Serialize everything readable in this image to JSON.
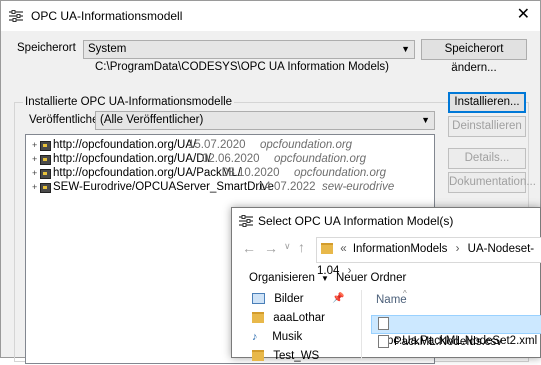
{
  "window": {
    "title": "OPC UA-Informationsmodell",
    "close_glyph": "✕"
  },
  "storage": {
    "label": "Speicherort",
    "value": "System",
    "path": "C:\\ProgramData\\CODESYS\\OPC UA Information Models)",
    "change_button": "Speicherort ändern..."
  },
  "installed": {
    "group_label": "Installierte OPC UA-Informationsmodelle",
    "publisher_label": "Veröffentlicher:",
    "publisher_value": "(Alle Veröffentlicher)",
    "items": [
      {
        "url": "http://opcfoundation.org/UA/",
        "date": "15.07.2020",
        "org": "opcfoundation.org"
      },
      {
        "url": "http://opcfoundation.org/UA/DI/",
        "date": "02.06.2020",
        "org": "opcfoundation.org"
      },
      {
        "url": "http://opcfoundation.org/UA/PackML/",
        "date": "08.10.2020",
        "org": "opcfoundation.org"
      },
      {
        "url": "SEW-Eurodrive/OPCUAServer_SmartDrive",
        "date": "14.07.2022",
        "org": "sew-eurodrive"
      }
    ]
  },
  "buttons": {
    "install": "Installieren...",
    "uninstall": "Deinstallieren",
    "details": "Details...",
    "docs": "Dokumentation..."
  },
  "file_dialog": {
    "title": "Select OPC UA Information Model(s)",
    "breadcrumb": [
      "«",
      "InformationModels",
      "›",
      "UA-Nodeset-1.04",
      "›"
    ],
    "organize": "Organisieren",
    "new_folder": "Neuer Ordner",
    "nav_items": [
      "Bilder",
      "aaaLothar",
      "Musik",
      "Test_WS"
    ],
    "column_name": "Name",
    "files": [
      "Opc.Ua.PackML.NodeSet2.xml",
      "PackML.NodeIds.csv"
    ]
  },
  "colors": {
    "selection": "#cce8ff",
    "selection_border": "#99d1ff",
    "focus": "#0078d7"
  }
}
